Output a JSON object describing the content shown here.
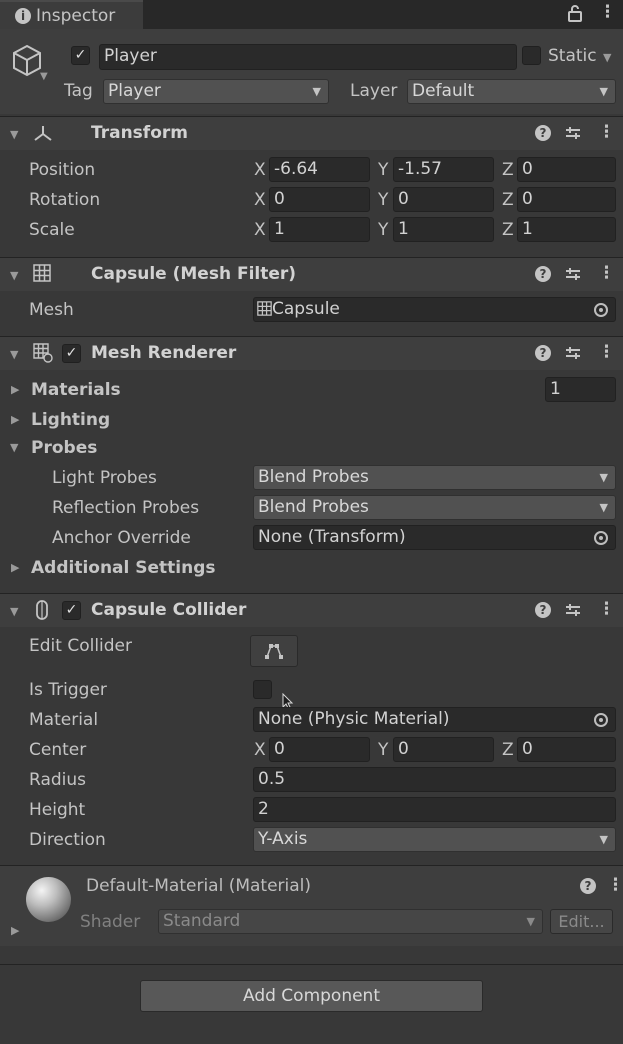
{
  "window": {
    "tab_label": "Inspector"
  },
  "object": {
    "enabled": true,
    "name": "Player",
    "static_label": "Static",
    "tag_label": "Tag",
    "tag_value": "Player",
    "layer_label": "Layer",
    "layer_value": "Default"
  },
  "transform": {
    "title": "Transform",
    "position_label": "Position",
    "rotation_label": "Rotation",
    "scale_label": "Scale",
    "position": {
      "x": "-6.64",
      "y": "-1.57",
      "z": "0"
    },
    "rotation": {
      "x": "0",
      "y": "0",
      "z": "0"
    },
    "scale": {
      "x": "1",
      "y": "1",
      "z": "1"
    },
    "axis": {
      "x": "X",
      "y": "Y",
      "z": "Z"
    }
  },
  "mesh_filter": {
    "title": "Capsule (Mesh Filter)",
    "mesh_label": "Mesh",
    "mesh_value": "Capsule"
  },
  "mesh_renderer": {
    "title": "Mesh Renderer",
    "materials_label": "Materials",
    "materials_count": "1",
    "lighting_label": "Lighting",
    "probes_label": "Probes",
    "light_probes_label": "Light Probes",
    "light_probes_value": "Blend Probes",
    "reflection_probes_label": "Reflection Probes",
    "reflection_probes_value": "Blend Probes",
    "anchor_override_label": "Anchor Override",
    "anchor_override_value": "None (Transform)",
    "additional_settings_label": "Additional Settings"
  },
  "capsule_collider": {
    "title": "Capsule Collider",
    "edit_collider_label": "Edit Collider",
    "is_trigger_label": "Is Trigger",
    "material_label": "Material",
    "material_value": "None (Physic Material)",
    "center_label": "Center",
    "center": {
      "x": "0",
      "y": "0",
      "z": "0"
    },
    "radius_label": "Radius",
    "radius_value": "0.5",
    "height_label": "Height",
    "height_value": "2",
    "direction_label": "Direction",
    "direction_value": "Y-Axis"
  },
  "material": {
    "title": "Default-Material (Material)",
    "shader_label": "Shader",
    "shader_value": "Standard",
    "edit_label": "Edit..."
  },
  "add_component_label": "Add Component",
  "icons": {
    "info": "i",
    "lock": "lock-icon",
    "kebab": "⋮",
    "help": "?",
    "presets": "presets-icon"
  }
}
